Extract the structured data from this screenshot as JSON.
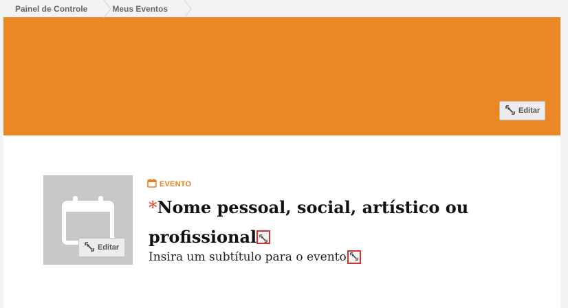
{
  "breadcrumb": {
    "items": [
      {
        "label": "Painel de Controle"
      },
      {
        "label": "Meus Eventos"
      }
    ]
  },
  "banner": {
    "color": "#ec8823",
    "edit_label": "Editar",
    "edit_icon": "edit-icon"
  },
  "thumbnail": {
    "icon": "calendar-icon",
    "edit_label": "Editar"
  },
  "event": {
    "type_label": "EVENTO",
    "type_icon": "calendar-icon",
    "required_marker": "*",
    "title": "Nome pessoal, social, artístico ou profissional",
    "subtitle": "Insira um subtítulo para o evento"
  }
}
